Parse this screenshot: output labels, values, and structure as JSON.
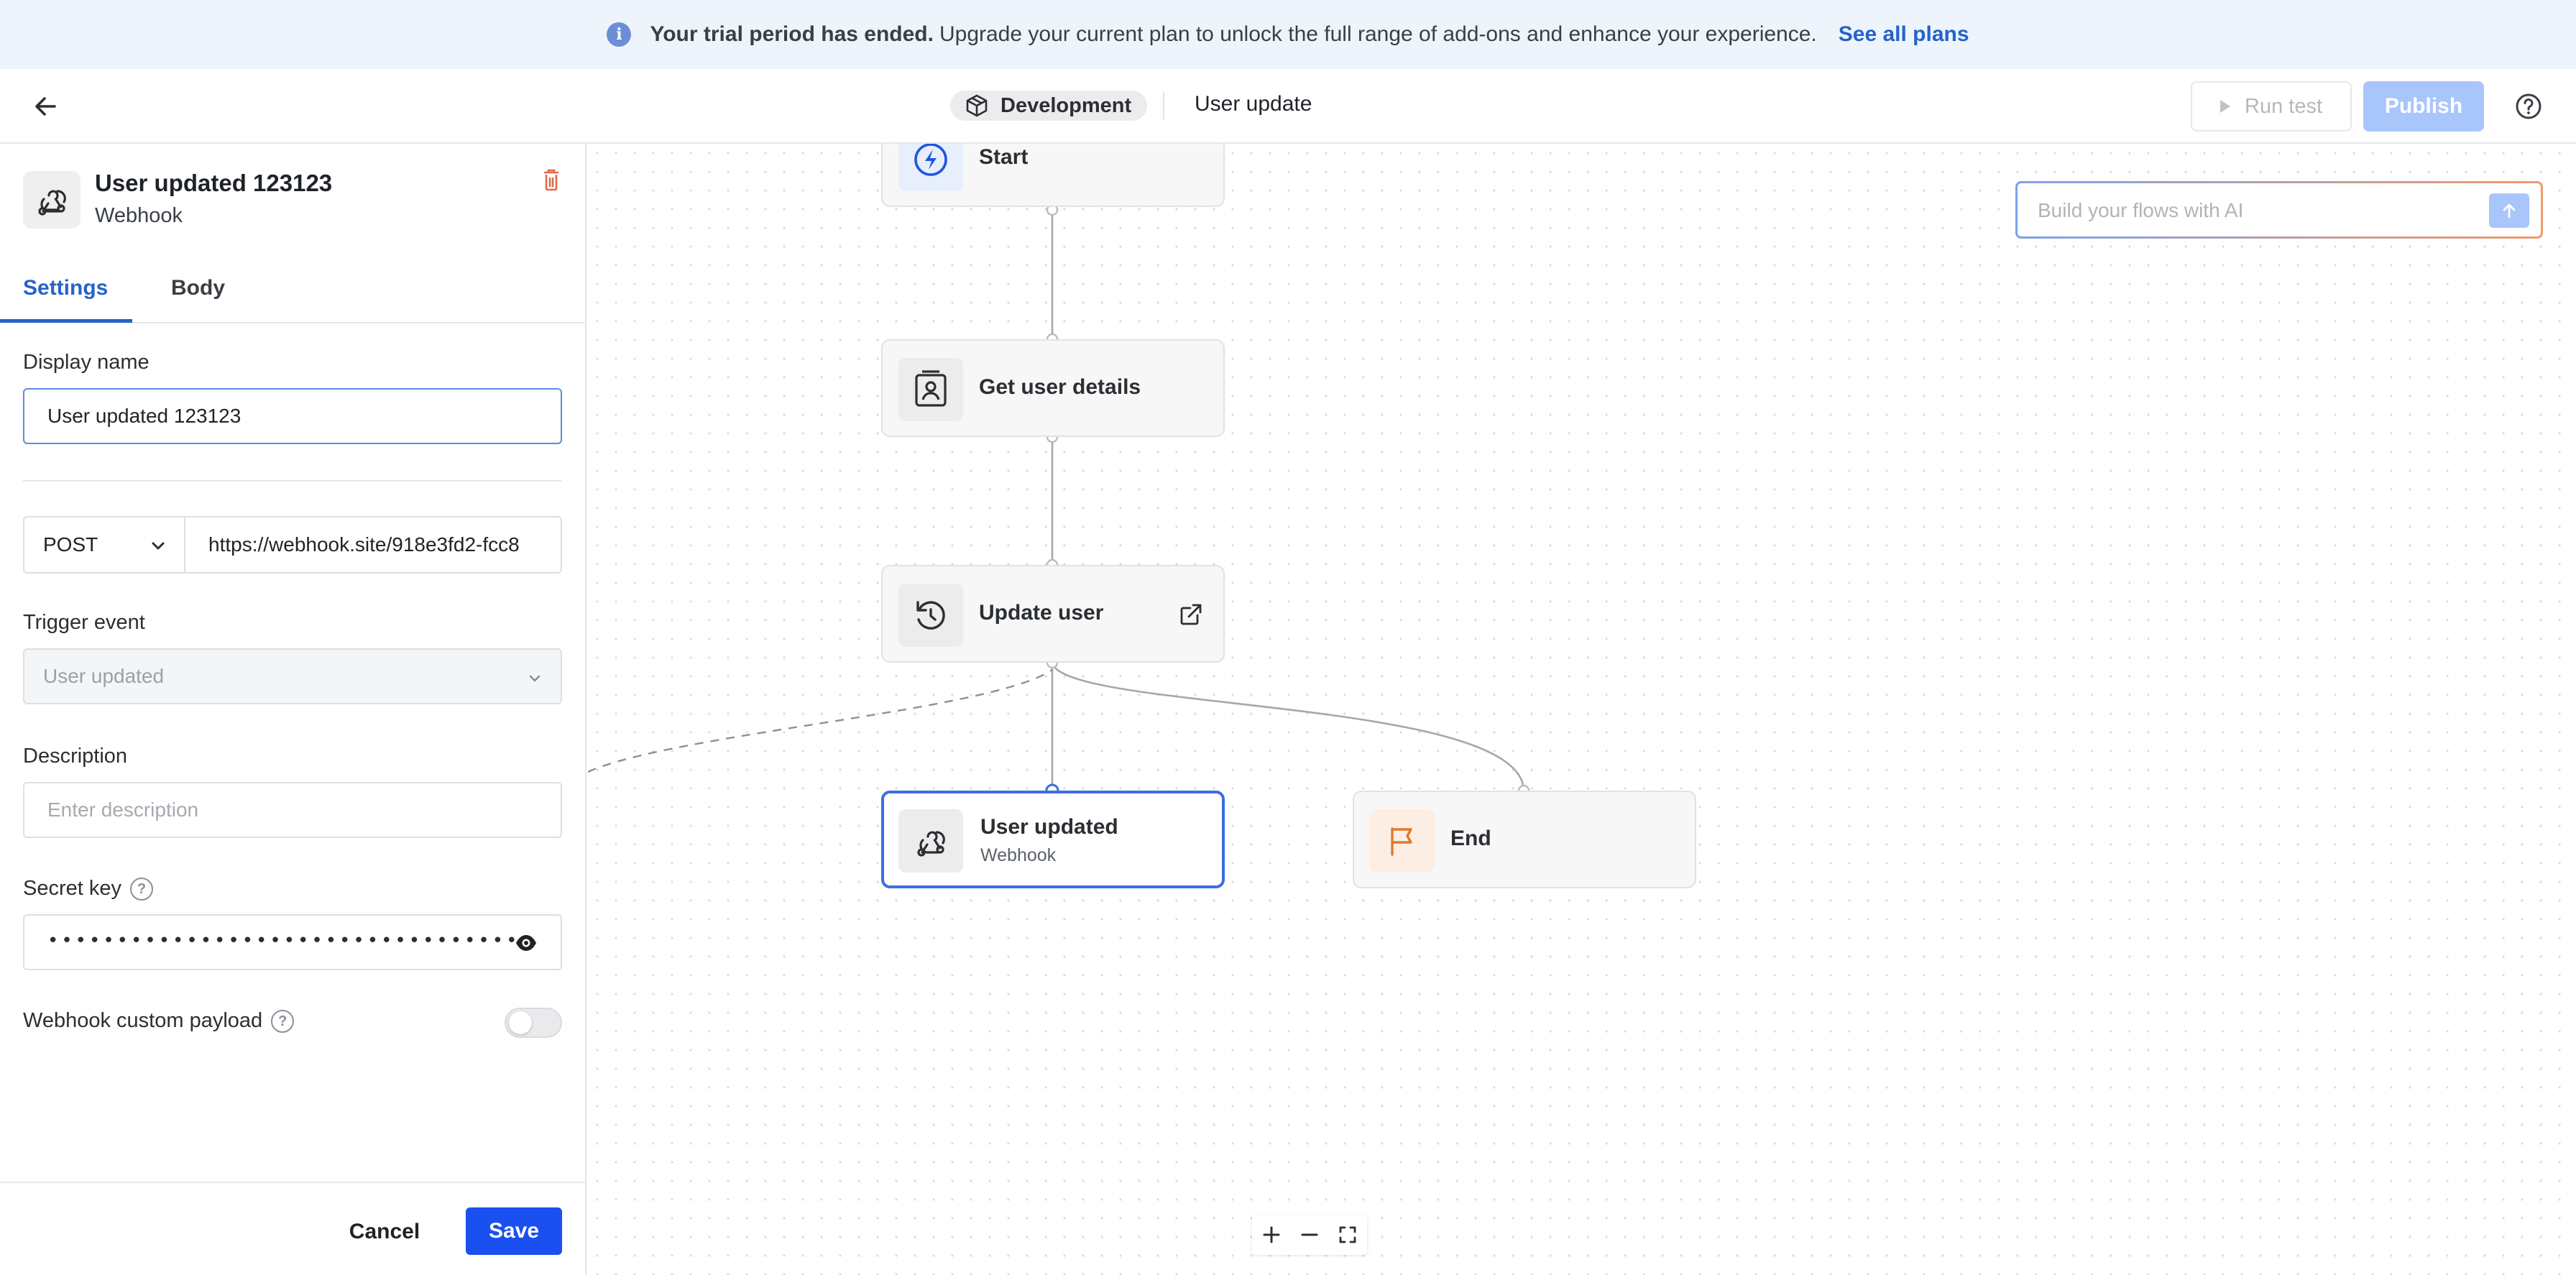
{
  "banner": {
    "bold_text": "Your trial period has ended.",
    "text": "Upgrade your current plan to unlock the full range of add-ons and enhance your experience.",
    "link": "See all plans",
    "icon": "info-icon"
  },
  "header": {
    "environment": "Development",
    "flow_name": "User update",
    "run_test_label": "Run test",
    "publish_label": "Publish",
    "icons": [
      "back-arrow-icon",
      "package-icon",
      "play-icon",
      "help-icon"
    ]
  },
  "panel": {
    "title": "User updated 123123",
    "subtitle": "Webhook",
    "tabs": [
      "Settings",
      "Body"
    ],
    "active_tab": "Settings",
    "display_name_label": "Display name",
    "display_name_value": "User updated 123123",
    "method": "POST",
    "url": "https://webhook.site/918e3fd2-fcc8",
    "trigger_event_label": "Trigger event",
    "trigger_event_value": "User updated",
    "description_label": "Description",
    "description_placeholder": "Enter description",
    "secret_key_label": "Secret key",
    "secret_key_mask": "••••••••••••••••••••••••••••••••••",
    "custom_payload_label": "Webhook custom payload",
    "custom_payload_enabled": false,
    "cancel_label": "Cancel",
    "save_label": "Save"
  },
  "canvas": {
    "ai_placeholder": "Build your flows with AI",
    "nodes": [
      {
        "label": "Start",
        "icon": "lightning-icon"
      },
      {
        "label": "Get user details",
        "icon": "user-card-icon"
      },
      {
        "label": "Update user",
        "icon": "refresh-icon"
      },
      {
        "label": "User updated",
        "sub": "Webhook",
        "icon": "webhook-icon",
        "selected": true
      },
      {
        "label": "End",
        "icon": "flag-icon"
      }
    ]
  },
  "colors": {
    "accent": "#2563c9",
    "save_button": "#1a4ff0",
    "publish_disabled": "#a9c6fb",
    "banner_bg": "#eef4fc",
    "selected_border": "#3b6fe0",
    "end_flag": "#e07a2e"
  }
}
